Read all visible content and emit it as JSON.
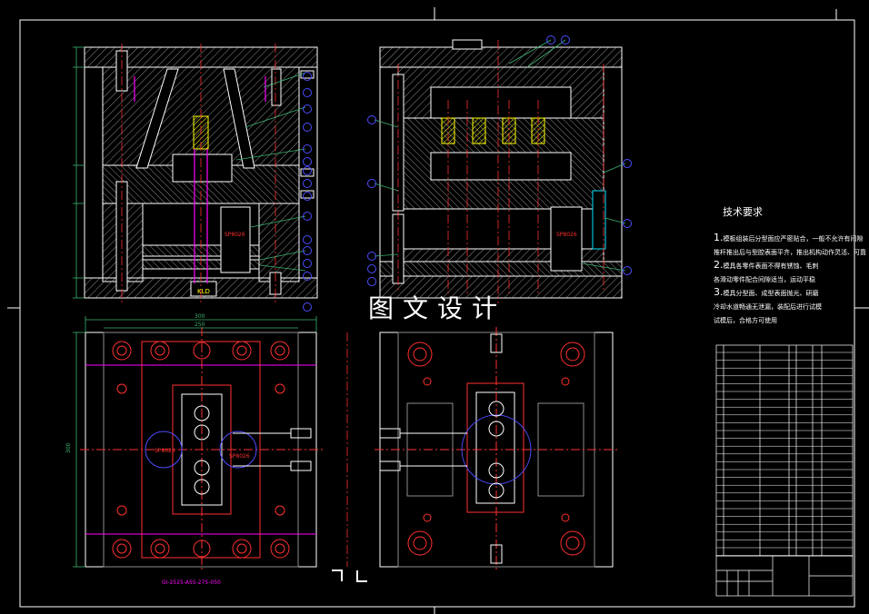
{
  "watermark": "图文设计",
  "technical_requirements": {
    "title": "技术要求",
    "lines": [
      {
        "num": "1.",
        "text": "模板组装后分型面应严密贴合，一般不允许有间隙"
      },
      {
        "num": "",
        "text": "推杆推出后与型腔表面平齐，推出机构动作灵活、可靠"
      },
      {
        "num": "2.",
        "text": "模具各零件表面不得有锈蚀、毛刺"
      },
      {
        "num": "",
        "text": "各滑动零件配合间隙适当，运动平稳"
      },
      {
        "num": "3.",
        "text": "模具分型面、成型表面抛光、研磨"
      },
      {
        "num": "",
        "text": "冷却水道畅通无泄漏，装配后进行试模"
      },
      {
        "num": "",
        "text": "试模后，合格方可使用"
      }
    ]
  },
  "part_labels": {
    "front_view_block": "KLD",
    "spring_label": "SP8026",
    "plan_circle_left": "SP8026",
    "plan_circle_right": "SP8026",
    "bottom_caption": "GI-2525-A55-275-050"
  },
  "dimensions": {
    "width_outer": "300",
    "width_inner": "250",
    "height_plan": "300"
  },
  "colors": {
    "background": "#000000",
    "outline": "#ffffff",
    "hatch": "#9a9a9a",
    "leader": "#3cb371",
    "centerline": "#ff3030",
    "cavity": "#ffff00",
    "pin": "#ff00ff",
    "dimension": "#00e5ff",
    "balloon": "#4d4dff"
  }
}
